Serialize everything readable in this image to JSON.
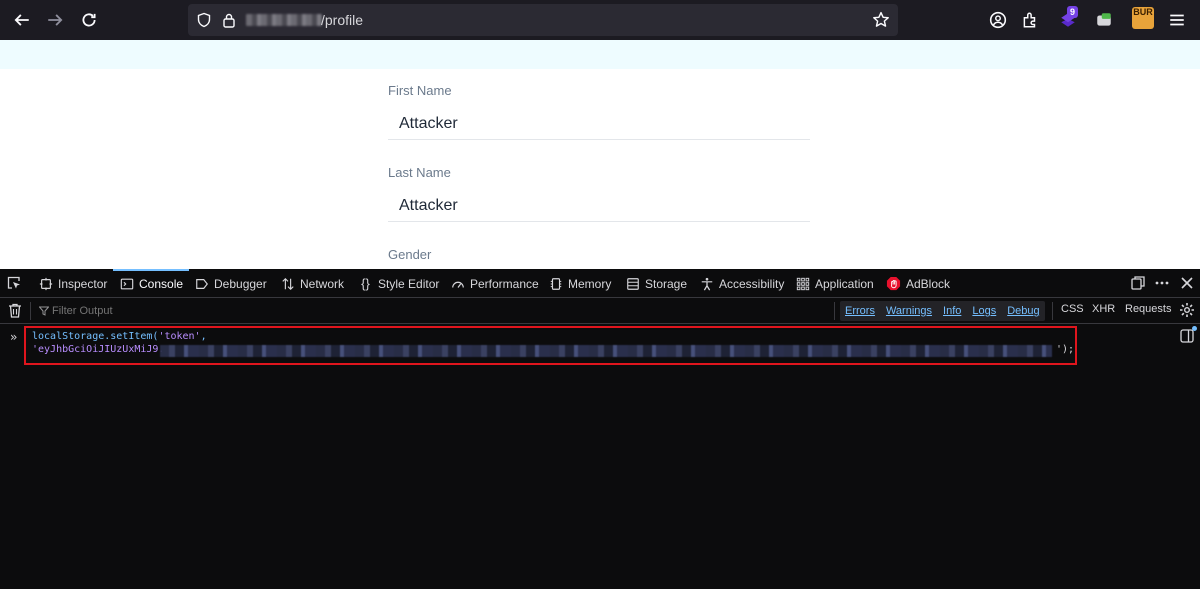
{
  "browser": {
    "url_path": "/profile",
    "extension_badge": "9",
    "burp_label": "BUR"
  },
  "page": {
    "fields": [
      {
        "label": "First Name",
        "value": "Attacker"
      },
      {
        "label": "Last Name",
        "value": "Attacker"
      },
      {
        "label": "Gender",
        "value": ""
      }
    ]
  },
  "devtools": {
    "tabs": [
      {
        "label": "Inspector",
        "icon": "inspector-icon"
      },
      {
        "label": "Console",
        "icon": "console-icon"
      },
      {
        "label": "Debugger",
        "icon": "debugger-icon"
      },
      {
        "label": "Network",
        "icon": "network-icon"
      },
      {
        "label": "Style Editor",
        "icon": "style-editor-icon"
      },
      {
        "label": "Performance",
        "icon": "performance-icon"
      },
      {
        "label": "Memory",
        "icon": "memory-icon"
      },
      {
        "label": "Storage",
        "icon": "storage-icon"
      },
      {
        "label": "Accessibility",
        "icon": "accessibility-icon"
      },
      {
        "label": "Application",
        "icon": "application-icon"
      },
      {
        "label": "AdBlock",
        "icon": "adblock-icon"
      }
    ],
    "active_tab": "Console",
    "filter_placeholder": "Filter Output",
    "levels": [
      "Errors",
      "Warnings",
      "Info",
      "Logs",
      "Debug"
    ],
    "request_filters": [
      "CSS",
      "XHR",
      "Requests"
    ],
    "prompt": "»",
    "command": {
      "line1_call": "localStorage.setItem(",
      "line1_key": "'token'",
      "line1_end": ",",
      "line2_start": "'eyJhbGciOiJIUzUxMiJ9.",
      "line2_end": "');"
    },
    "highlight_color": "#e0151d"
  }
}
